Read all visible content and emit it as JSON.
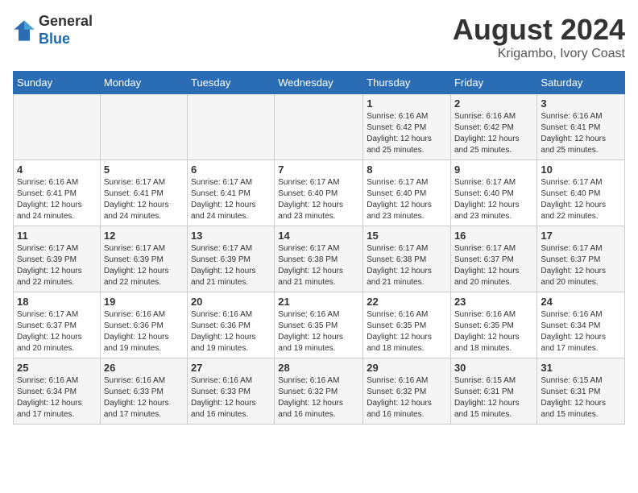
{
  "header": {
    "logo_line1": "General",
    "logo_line2": "Blue",
    "month_year": "August 2024",
    "location": "Krigambo, Ivory Coast"
  },
  "weekdays": [
    "Sunday",
    "Monday",
    "Tuesday",
    "Wednesday",
    "Thursday",
    "Friday",
    "Saturday"
  ],
  "weeks": [
    [
      {
        "day": "",
        "info": ""
      },
      {
        "day": "",
        "info": ""
      },
      {
        "day": "",
        "info": ""
      },
      {
        "day": "",
        "info": ""
      },
      {
        "day": "1",
        "info": "Sunrise: 6:16 AM\nSunset: 6:42 PM\nDaylight: 12 hours\nand 25 minutes."
      },
      {
        "day": "2",
        "info": "Sunrise: 6:16 AM\nSunset: 6:42 PM\nDaylight: 12 hours\nand 25 minutes."
      },
      {
        "day": "3",
        "info": "Sunrise: 6:16 AM\nSunset: 6:41 PM\nDaylight: 12 hours\nand 25 minutes."
      }
    ],
    [
      {
        "day": "4",
        "info": "Sunrise: 6:16 AM\nSunset: 6:41 PM\nDaylight: 12 hours\nand 24 minutes."
      },
      {
        "day": "5",
        "info": "Sunrise: 6:17 AM\nSunset: 6:41 PM\nDaylight: 12 hours\nand 24 minutes."
      },
      {
        "day": "6",
        "info": "Sunrise: 6:17 AM\nSunset: 6:41 PM\nDaylight: 12 hours\nand 24 minutes."
      },
      {
        "day": "7",
        "info": "Sunrise: 6:17 AM\nSunset: 6:40 PM\nDaylight: 12 hours\nand 23 minutes."
      },
      {
        "day": "8",
        "info": "Sunrise: 6:17 AM\nSunset: 6:40 PM\nDaylight: 12 hours\nand 23 minutes."
      },
      {
        "day": "9",
        "info": "Sunrise: 6:17 AM\nSunset: 6:40 PM\nDaylight: 12 hours\nand 23 minutes."
      },
      {
        "day": "10",
        "info": "Sunrise: 6:17 AM\nSunset: 6:40 PM\nDaylight: 12 hours\nand 22 minutes."
      }
    ],
    [
      {
        "day": "11",
        "info": "Sunrise: 6:17 AM\nSunset: 6:39 PM\nDaylight: 12 hours\nand 22 minutes."
      },
      {
        "day": "12",
        "info": "Sunrise: 6:17 AM\nSunset: 6:39 PM\nDaylight: 12 hours\nand 22 minutes."
      },
      {
        "day": "13",
        "info": "Sunrise: 6:17 AM\nSunset: 6:39 PM\nDaylight: 12 hours\nand 21 minutes."
      },
      {
        "day": "14",
        "info": "Sunrise: 6:17 AM\nSunset: 6:38 PM\nDaylight: 12 hours\nand 21 minutes."
      },
      {
        "day": "15",
        "info": "Sunrise: 6:17 AM\nSunset: 6:38 PM\nDaylight: 12 hours\nand 21 minutes."
      },
      {
        "day": "16",
        "info": "Sunrise: 6:17 AM\nSunset: 6:37 PM\nDaylight: 12 hours\nand 20 minutes."
      },
      {
        "day": "17",
        "info": "Sunrise: 6:17 AM\nSunset: 6:37 PM\nDaylight: 12 hours\nand 20 minutes."
      }
    ],
    [
      {
        "day": "18",
        "info": "Sunrise: 6:17 AM\nSunset: 6:37 PM\nDaylight: 12 hours\nand 20 minutes."
      },
      {
        "day": "19",
        "info": "Sunrise: 6:16 AM\nSunset: 6:36 PM\nDaylight: 12 hours\nand 19 minutes."
      },
      {
        "day": "20",
        "info": "Sunrise: 6:16 AM\nSunset: 6:36 PM\nDaylight: 12 hours\nand 19 minutes."
      },
      {
        "day": "21",
        "info": "Sunrise: 6:16 AM\nSunset: 6:35 PM\nDaylight: 12 hours\nand 19 minutes."
      },
      {
        "day": "22",
        "info": "Sunrise: 6:16 AM\nSunset: 6:35 PM\nDaylight: 12 hours\nand 18 minutes."
      },
      {
        "day": "23",
        "info": "Sunrise: 6:16 AM\nSunset: 6:35 PM\nDaylight: 12 hours\nand 18 minutes."
      },
      {
        "day": "24",
        "info": "Sunrise: 6:16 AM\nSunset: 6:34 PM\nDaylight: 12 hours\nand 17 minutes."
      }
    ],
    [
      {
        "day": "25",
        "info": "Sunrise: 6:16 AM\nSunset: 6:34 PM\nDaylight: 12 hours\nand 17 minutes."
      },
      {
        "day": "26",
        "info": "Sunrise: 6:16 AM\nSunset: 6:33 PM\nDaylight: 12 hours\nand 17 minutes."
      },
      {
        "day": "27",
        "info": "Sunrise: 6:16 AM\nSunset: 6:33 PM\nDaylight: 12 hours\nand 16 minutes."
      },
      {
        "day": "28",
        "info": "Sunrise: 6:16 AM\nSunset: 6:32 PM\nDaylight: 12 hours\nand 16 minutes."
      },
      {
        "day": "29",
        "info": "Sunrise: 6:16 AM\nSunset: 6:32 PM\nDaylight: 12 hours\nand 16 minutes."
      },
      {
        "day": "30",
        "info": "Sunrise: 6:15 AM\nSunset: 6:31 PM\nDaylight: 12 hours\nand 15 minutes."
      },
      {
        "day": "31",
        "info": "Sunrise: 6:15 AM\nSunset: 6:31 PM\nDaylight: 12 hours\nand 15 minutes."
      }
    ]
  ]
}
